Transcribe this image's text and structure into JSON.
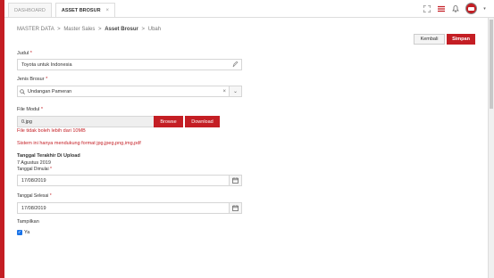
{
  "tabs": [
    {
      "label": "DASHBOARD"
    },
    {
      "label": "ASSET BROSUR",
      "close": "×"
    }
  ],
  "icons": {
    "fullscreen": "fullscreen-icon",
    "menu": "menu-icon",
    "bell": "bell-icon",
    "user": "user-avatar",
    "chevron": "chevron-down-icon"
  },
  "accent_color": "#c41e24",
  "breadcrumb": {
    "items": [
      "MASTER DATA",
      "Master Sales",
      "Asset Brosur",
      "Ubah"
    ],
    "sep": ">"
  },
  "actions": {
    "kembali": "Kembali",
    "simpan": "Simpan"
  },
  "form": {
    "judul": {
      "label": "Judul",
      "required": "*",
      "value": "Toyota untuk Indonesia"
    },
    "jenis_brosur": {
      "label": "Jenis Brosur",
      "required": "*",
      "value": "Undangan Pameran",
      "clear": "×",
      "caret": "⌄"
    },
    "file_modul": {
      "label": "File Modul",
      "required": "*",
      "value": "0.jpg",
      "browse": "Browse",
      "download": "Download",
      "note_size": "File tidak boleh lebih dari 10MB",
      "note_format": "Sistem ini hanya mendukung format jpg,jpeg,png,img,pdf"
    },
    "tanggal_upload": {
      "label": "Tanggal Terakhir Di Upload",
      "value": "7 Agustus 2019"
    },
    "tanggal_dimulai": {
      "label": "Tanggal Dimulai",
      "required": "*",
      "value": "17/08/2019"
    },
    "tanggal_selesai": {
      "label": "Tanggal Selesai",
      "required": "*",
      "value": "17/08/2019"
    },
    "tampilkan": {
      "label": "Tampilkan",
      "option": "Ya",
      "checked": true
    }
  }
}
